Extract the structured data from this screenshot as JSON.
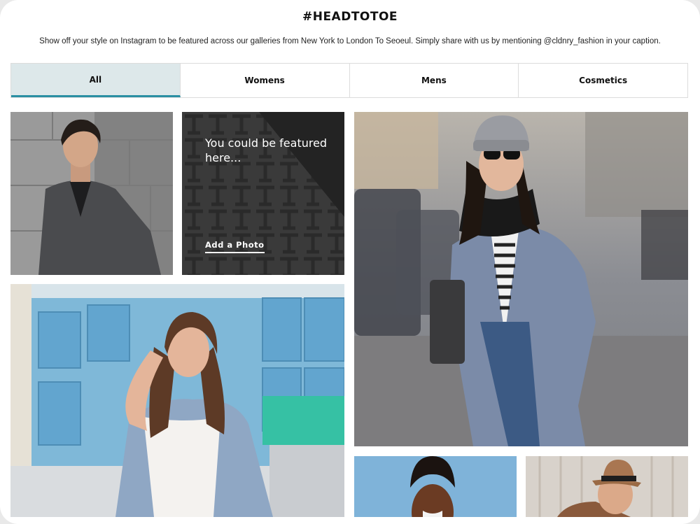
{
  "header": {
    "title": "#HEADTOTOE",
    "subtitle": "Show off your style on Instagram to be featured across our galleries from New York to London To Seoeul. Simply share with us by mentioning @cldnry_fashion in your caption."
  },
  "tabs": [
    {
      "label": "All",
      "active": true
    },
    {
      "label": "Womens",
      "active": false
    },
    {
      "label": "Mens",
      "active": false
    },
    {
      "label": "Cosmetics",
      "active": false
    }
  ],
  "gallery": {
    "feature_card": {
      "text": "You could be featured here...",
      "cta": "Add a Photo"
    },
    "photos": [
      {
        "name": "photo-man-grey-coat"
      },
      {
        "name": "photo-woman-denim-jacket"
      },
      {
        "name": "photo-woman-blue-coat-beanie"
      },
      {
        "name": "photo-woman-blue-background"
      },
      {
        "name": "photo-man-hat"
      }
    ]
  },
  "colors": {
    "active_tab_bg": "#dde8ea",
    "active_tab_underline": "#2a8fa3",
    "feature_card_bg": "#222222"
  }
}
